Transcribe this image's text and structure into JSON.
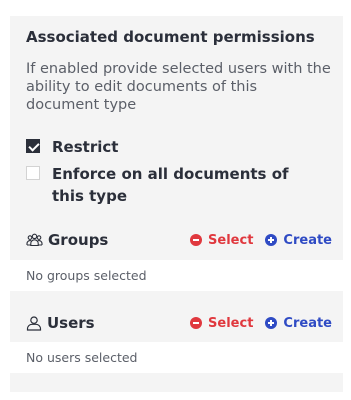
{
  "panel": {
    "title": "Associated document permissions",
    "description": "If enabled provide selected users with the ability to edit documents of this document type",
    "options": [
      {
        "label": "Restrict",
        "checked": true
      },
      {
        "label": "Enforce on all documents of this type",
        "checked": false
      }
    ]
  },
  "groups": {
    "title": "Groups",
    "icon": "groups-icon",
    "select_label": "Select",
    "create_label": "Create",
    "empty_text": "No groups selected"
  },
  "users": {
    "title": "Users",
    "icon": "user-icon",
    "select_label": "Select",
    "create_label": "Create",
    "empty_text": "No users selected"
  },
  "colors": {
    "select": "#e0383e",
    "create": "#2f4bc4",
    "text": "#2b2f3a",
    "panel_bg": "#f4f4f4"
  }
}
